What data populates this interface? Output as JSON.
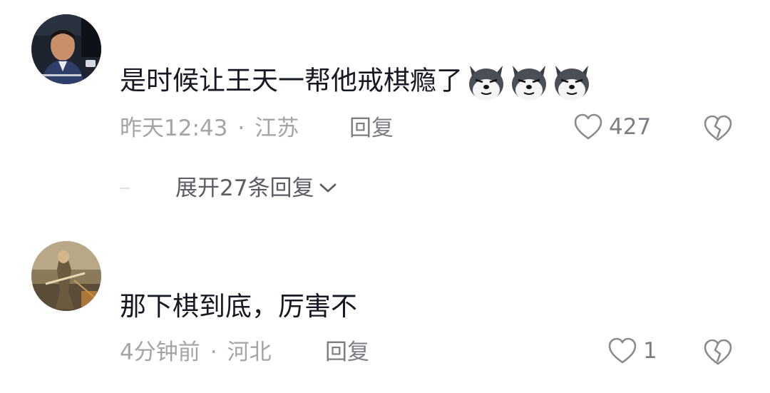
{
  "comments": [
    {
      "text": "是时候让王天一帮他戒棋瘾了",
      "emoji_icons": [
        "husky-dog-emoji-icon",
        "husky-dog-emoji-icon",
        "husky-dog-emoji-icon"
      ],
      "time": "昨天12:43",
      "location": "江苏",
      "reply_label": "回复",
      "like_count": "427",
      "expand_label": "展开27条回复"
    },
    {
      "text": "那下棋到底，厉害不",
      "time": "4分钟前",
      "location": "河北",
      "reply_label": "回复",
      "like_count": "1"
    }
  ],
  "separator": "·",
  "colors": {
    "text": "#161823",
    "meta": "#a3a4a8",
    "action": "#7d7e84",
    "expand": "#5c5d64"
  }
}
